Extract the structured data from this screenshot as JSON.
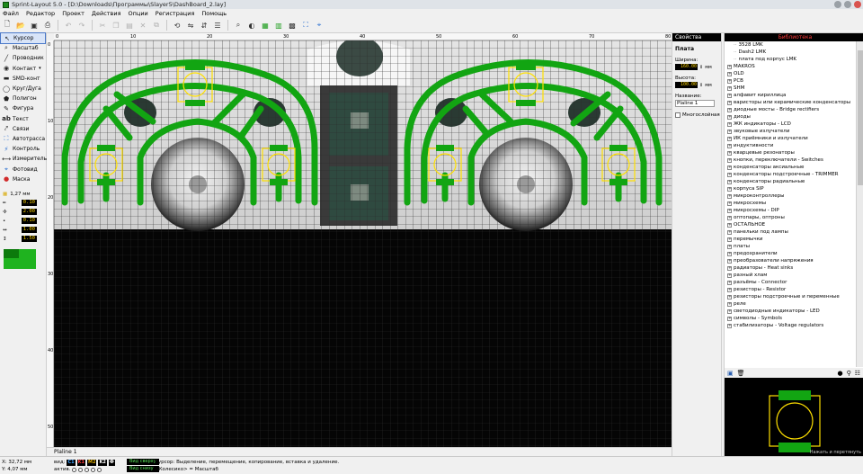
{
  "window": {
    "title": "Sprint-Layout 5.0 - [D:\\Downloads\\Программы\\Slayer5\\DashBoard_2.lay]"
  },
  "menu": [
    "Файл",
    "Редактор",
    "Проект",
    "Действия",
    "Опции",
    "Регистрация",
    "Помощь"
  ],
  "toolbar": {
    "icons": [
      "new-file-icon",
      "open-folder-icon",
      "save-icon",
      "print-icon",
      "undo-icon",
      "redo-icon",
      "cut-icon",
      "copy-icon",
      "paste-icon",
      "delete-icon",
      "duplicate-icon",
      "rotate-icon",
      "mirror-h-icon",
      "mirror-v-icon",
      "align-icon",
      "zoom-icon",
      "zoom-fit-icon",
      "grid-icon",
      "layers-icon",
      "drc-icon",
      "autoroute-icon",
      "photo-icon"
    ],
    "colors": {
      "green": "#1c9d1c",
      "blue": "#2a6fd1"
    }
  },
  "tools": [
    {
      "label": "Курсор",
      "icon": "cursor-icon",
      "active": true
    },
    {
      "label": "Масштаб",
      "icon": "zoom-icon"
    },
    {
      "label": "Проводник",
      "icon": "track-icon"
    },
    {
      "label": "Контакт",
      "icon": "pad-icon"
    },
    {
      "label": "SMD-конт",
      "icon": "smd-pad-icon"
    },
    {
      "label": "Круг/Дуга",
      "icon": "circle-arc-icon"
    },
    {
      "label": "Полигон",
      "icon": "polygon-icon"
    },
    {
      "label": "Фигура",
      "icon": "shape-icon"
    },
    {
      "label": "Текст",
      "icon": "text-icon"
    },
    {
      "label": "Связи",
      "icon": "connection-icon"
    },
    {
      "label": "Автотрасса",
      "icon": "autoroute-icon"
    },
    {
      "label": "Контроль",
      "icon": "test-icon"
    },
    {
      "label": "Измеритель",
      "icon": "measure-icon"
    },
    {
      "label": "Фотовид",
      "icon": "photoview-icon"
    },
    {
      "label": "Маска",
      "icon": "mask-icon"
    }
  ],
  "params": {
    "grid": "1,27 мм",
    "track_width": "0.10",
    "pad_outer": "2.00",
    "pad_inner": "0.10",
    "smd_w": "1.00",
    "smd_h": "1.50"
  },
  "rulers": {
    "top": [
      "0",
      "10",
      "20",
      "30",
      "40",
      "50",
      "60",
      "70",
      "80"
    ],
    "left": [
      "0",
      "10",
      "20",
      "30",
      "40",
      "50"
    ]
  },
  "canvas": {
    "colors": {
      "background": "#050505",
      "grid": "#2a2a2a",
      "track": "#12a512",
      "pad_outline": "#ffe000"
    },
    "tab_label": "Plaline 1"
  },
  "properties": {
    "header": "Свойства",
    "section": "Плата",
    "width_label": "Ширина:",
    "width_value": "160.00",
    "height_label": "Высота:",
    "height_value": "100.00",
    "unit": "мм",
    "name_label": "Название:",
    "name_value": "Plaline 1",
    "multilayer_label": "Многослойная"
  },
  "library": {
    "header": "Библиотека",
    "items": [
      {
        "label": "3528 LMK",
        "type": "leaf"
      },
      {
        "label": "Dash2 LMK",
        "type": "leaf"
      },
      {
        "label": "плата под корпус LMK",
        "type": "leaf"
      },
      {
        "label": "MAKROS",
        "type": "group"
      },
      {
        "label": "OLD",
        "type": "group"
      },
      {
        "label": "PCB",
        "type": "group"
      },
      {
        "label": "SHM",
        "type": "group"
      },
      {
        "label": "алфавит кириллица",
        "type": "group"
      },
      {
        "label": "варисторы или керамические конденсаторы",
        "type": "group"
      },
      {
        "label": "диодные мосты - Bridge rectifiers",
        "type": "group"
      },
      {
        "label": "диоды",
        "type": "group"
      },
      {
        "label": "ЖК индикаторы - LCD",
        "type": "group"
      },
      {
        "label": "звуковые излучатели",
        "type": "group"
      },
      {
        "label": "ИК приёмники и излучатели",
        "type": "group"
      },
      {
        "label": "индуктивности",
        "type": "group"
      },
      {
        "label": "кварцевые резонаторы",
        "type": "group"
      },
      {
        "label": "кнопки, переключатели - Switches",
        "type": "group"
      },
      {
        "label": "конденсаторы аксиальные",
        "type": "group"
      },
      {
        "label": "конденсаторы подстроечные - TRIMMER",
        "type": "group"
      },
      {
        "label": "конденсаторы радиальные",
        "type": "group"
      },
      {
        "label": "корпуса SIP",
        "type": "group"
      },
      {
        "label": "микроконтроллеры",
        "type": "group"
      },
      {
        "label": "микросхемы",
        "type": "group"
      },
      {
        "label": "микросхемы - DIP",
        "type": "group"
      },
      {
        "label": "оптопары, оптроны",
        "type": "group"
      },
      {
        "label": "ОСТАЛЬНОЕ",
        "type": "group"
      },
      {
        "label": "панельки под лампы",
        "type": "group"
      },
      {
        "label": "перемычки",
        "type": "group"
      },
      {
        "label": "платы",
        "type": "group"
      },
      {
        "label": "предохранители",
        "type": "group"
      },
      {
        "label": "преобразователи напряжения",
        "type": "group"
      },
      {
        "label": "радиаторы - Heat sinks",
        "type": "group"
      },
      {
        "label": "разный хлам",
        "type": "group"
      },
      {
        "label": "разъёмы - Connector",
        "type": "group"
      },
      {
        "label": "резисторы - Resistor",
        "type": "group"
      },
      {
        "label": "резисторы подстроечные и переменные",
        "type": "group"
      },
      {
        "label": "реле",
        "type": "group"
      },
      {
        "label": "светодиодные индикаторы - LED",
        "type": "group"
      },
      {
        "label": "символы - Symbols",
        "type": "group"
      },
      {
        "label": "стабилизаторы - Voltage regulators",
        "type": "group"
      }
    ],
    "tools_icons": [
      "save-icon",
      "trash-icon",
      "dot-icon",
      "filter-icon",
      "settings-icon"
    ],
    "preview_caption": "Нажать и перетянуть"
  },
  "status": {
    "x": "32,72 мм",
    "y": "4,07 мм",
    "x_label": "X:",
    "y_label": "Y:",
    "layers_label": "вид:",
    "active_label": "актив.",
    "layers": [
      "C1",
      "K1",
      "M2",
      "K2",
      "Ф"
    ],
    "view_top": "Вид сверху",
    "view_bottom": "Вид снизу",
    "help_line1": "Курсор: Выделение, перемещение, копирование, вставка и удаление.",
    "help_line2": "<Колесико> = Масштаб"
  }
}
